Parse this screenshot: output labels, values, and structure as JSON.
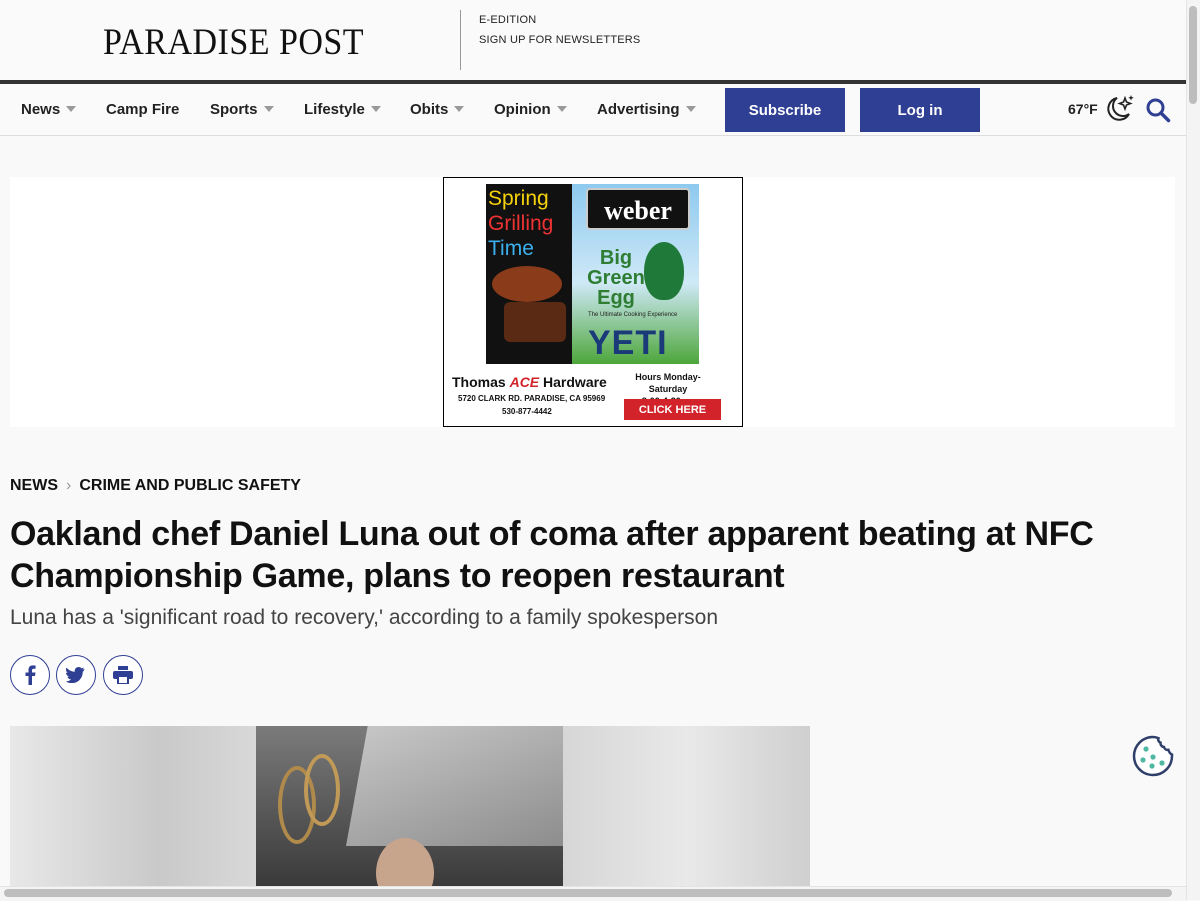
{
  "masthead": {
    "logo": "PARADISE POST",
    "links": [
      "E-EDITION",
      "SIGN UP FOR NEWSLETTERS"
    ]
  },
  "nav": {
    "items": [
      {
        "label": "News",
        "has_dropdown": true
      },
      {
        "label": "Camp Fire",
        "has_dropdown": false
      },
      {
        "label": "Sports",
        "has_dropdown": true
      },
      {
        "label": "Lifestyle",
        "has_dropdown": true
      },
      {
        "label": "Obits",
        "has_dropdown": true
      },
      {
        "label": "Opinion",
        "has_dropdown": true
      },
      {
        "label": "Advertising",
        "has_dropdown": true
      }
    ],
    "subscribe_label": "Subscribe",
    "login_label": "Log in",
    "temperature": "67°F",
    "weather_icon": "moon-stars-icon",
    "accent_color": "#2f3f93"
  },
  "ad": {
    "spring": "Spring",
    "grilling": "Grilling",
    "time": "Time",
    "weber": "weber",
    "big_green_egg": "Big Green Egg",
    "tagline": "The Ultimate Cooking Experience",
    "yeti": "YETI",
    "store_prefix": "Thomas",
    "store_ace": "ACE",
    "store_suffix": "Hardware",
    "address": "5720 CLARK RD. PARADISE, CA 95969",
    "phone": "530-877-4442",
    "hours_title": "Hours Monday-Saturday",
    "hours": "8:00-4:30pm",
    "cta": "CLICK HERE"
  },
  "article": {
    "breadcrumb": [
      "NEWS",
      "CRIME AND PUBLIC SAFETY"
    ],
    "headline": "Oakland chef Daniel Luna out of coma after apparent beating at NFC Championship Game, plans to reopen restaurant",
    "subhead": "Luna has a 'significant road to recovery,' according to a family spokesperson",
    "share_icons": [
      "facebook-icon",
      "twitter-icon",
      "print-icon"
    ]
  }
}
